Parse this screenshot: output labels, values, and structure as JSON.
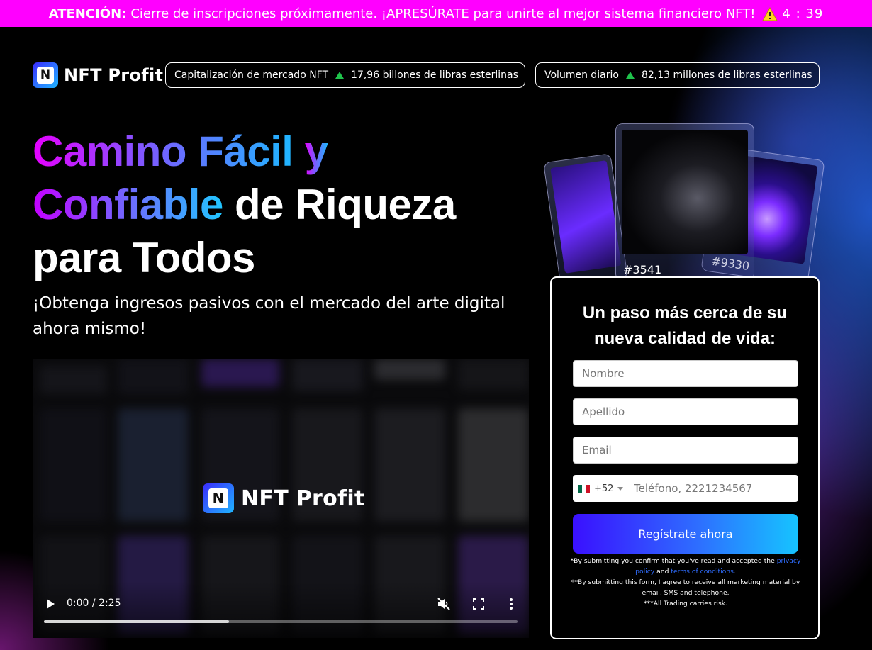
{
  "alert": {
    "lead": "ATENCIÓN:",
    "message": "Cierre de inscripciones próximamente. ¡APRESÚRATE para unirte al mejor sistema financiero NFT!",
    "timer": "4 : 39"
  },
  "brand": {
    "logo_letter": "N",
    "name": "NFT Profit"
  },
  "stats": {
    "market_cap_label": "Capitalización de mercado NFT",
    "market_cap_value": "17,96 billones de libras esterlinas",
    "daily_volume_label": "Volumen diario",
    "daily_volume_value": "82,13 millones de libras esterlinas"
  },
  "hero": {
    "title_part1": "Camino Fácil",
    "title_part2": "y",
    "title_part3": "Confiable",
    "title_part4": "de Riqueza",
    "title_part5": "para Todos",
    "subtitle": "¡Obtenga ingresos pasivos con el mercado del arte digital ahora mismo!"
  },
  "video": {
    "time": "0:00 / 2:25",
    "progress_buffered": 0.39
  },
  "nft_cards": {
    "middle_number": "#3541",
    "right_number": "#9330"
  },
  "form": {
    "title_line1": "Un paso más cerca de su",
    "title_line2": "nueva calidad de vida:",
    "first_name_placeholder": "Nombre",
    "last_name_placeholder": "Apellido",
    "email_placeholder": "Email",
    "country_code": "+52",
    "phone_placeholder": "Teléfono, 2221234567",
    "submit_label": "Regístrate ahora",
    "legal_1a": "*By submitting you confirm that you've read and accepted the",
    "privacy_link": "privacy policy",
    "legal_1b": "and",
    "terms_link": "terms of conditions",
    "legal_1c": ".",
    "legal_2": "**By submitting this form, I agree to receive all marketing material by email, SMS and telephone.",
    "legal_3": "***All Trading carries risk."
  },
  "colors": {
    "alert_bg": "#ff00ff",
    "up_arrow": "#1fc24b",
    "link": "#2f6dff"
  }
}
